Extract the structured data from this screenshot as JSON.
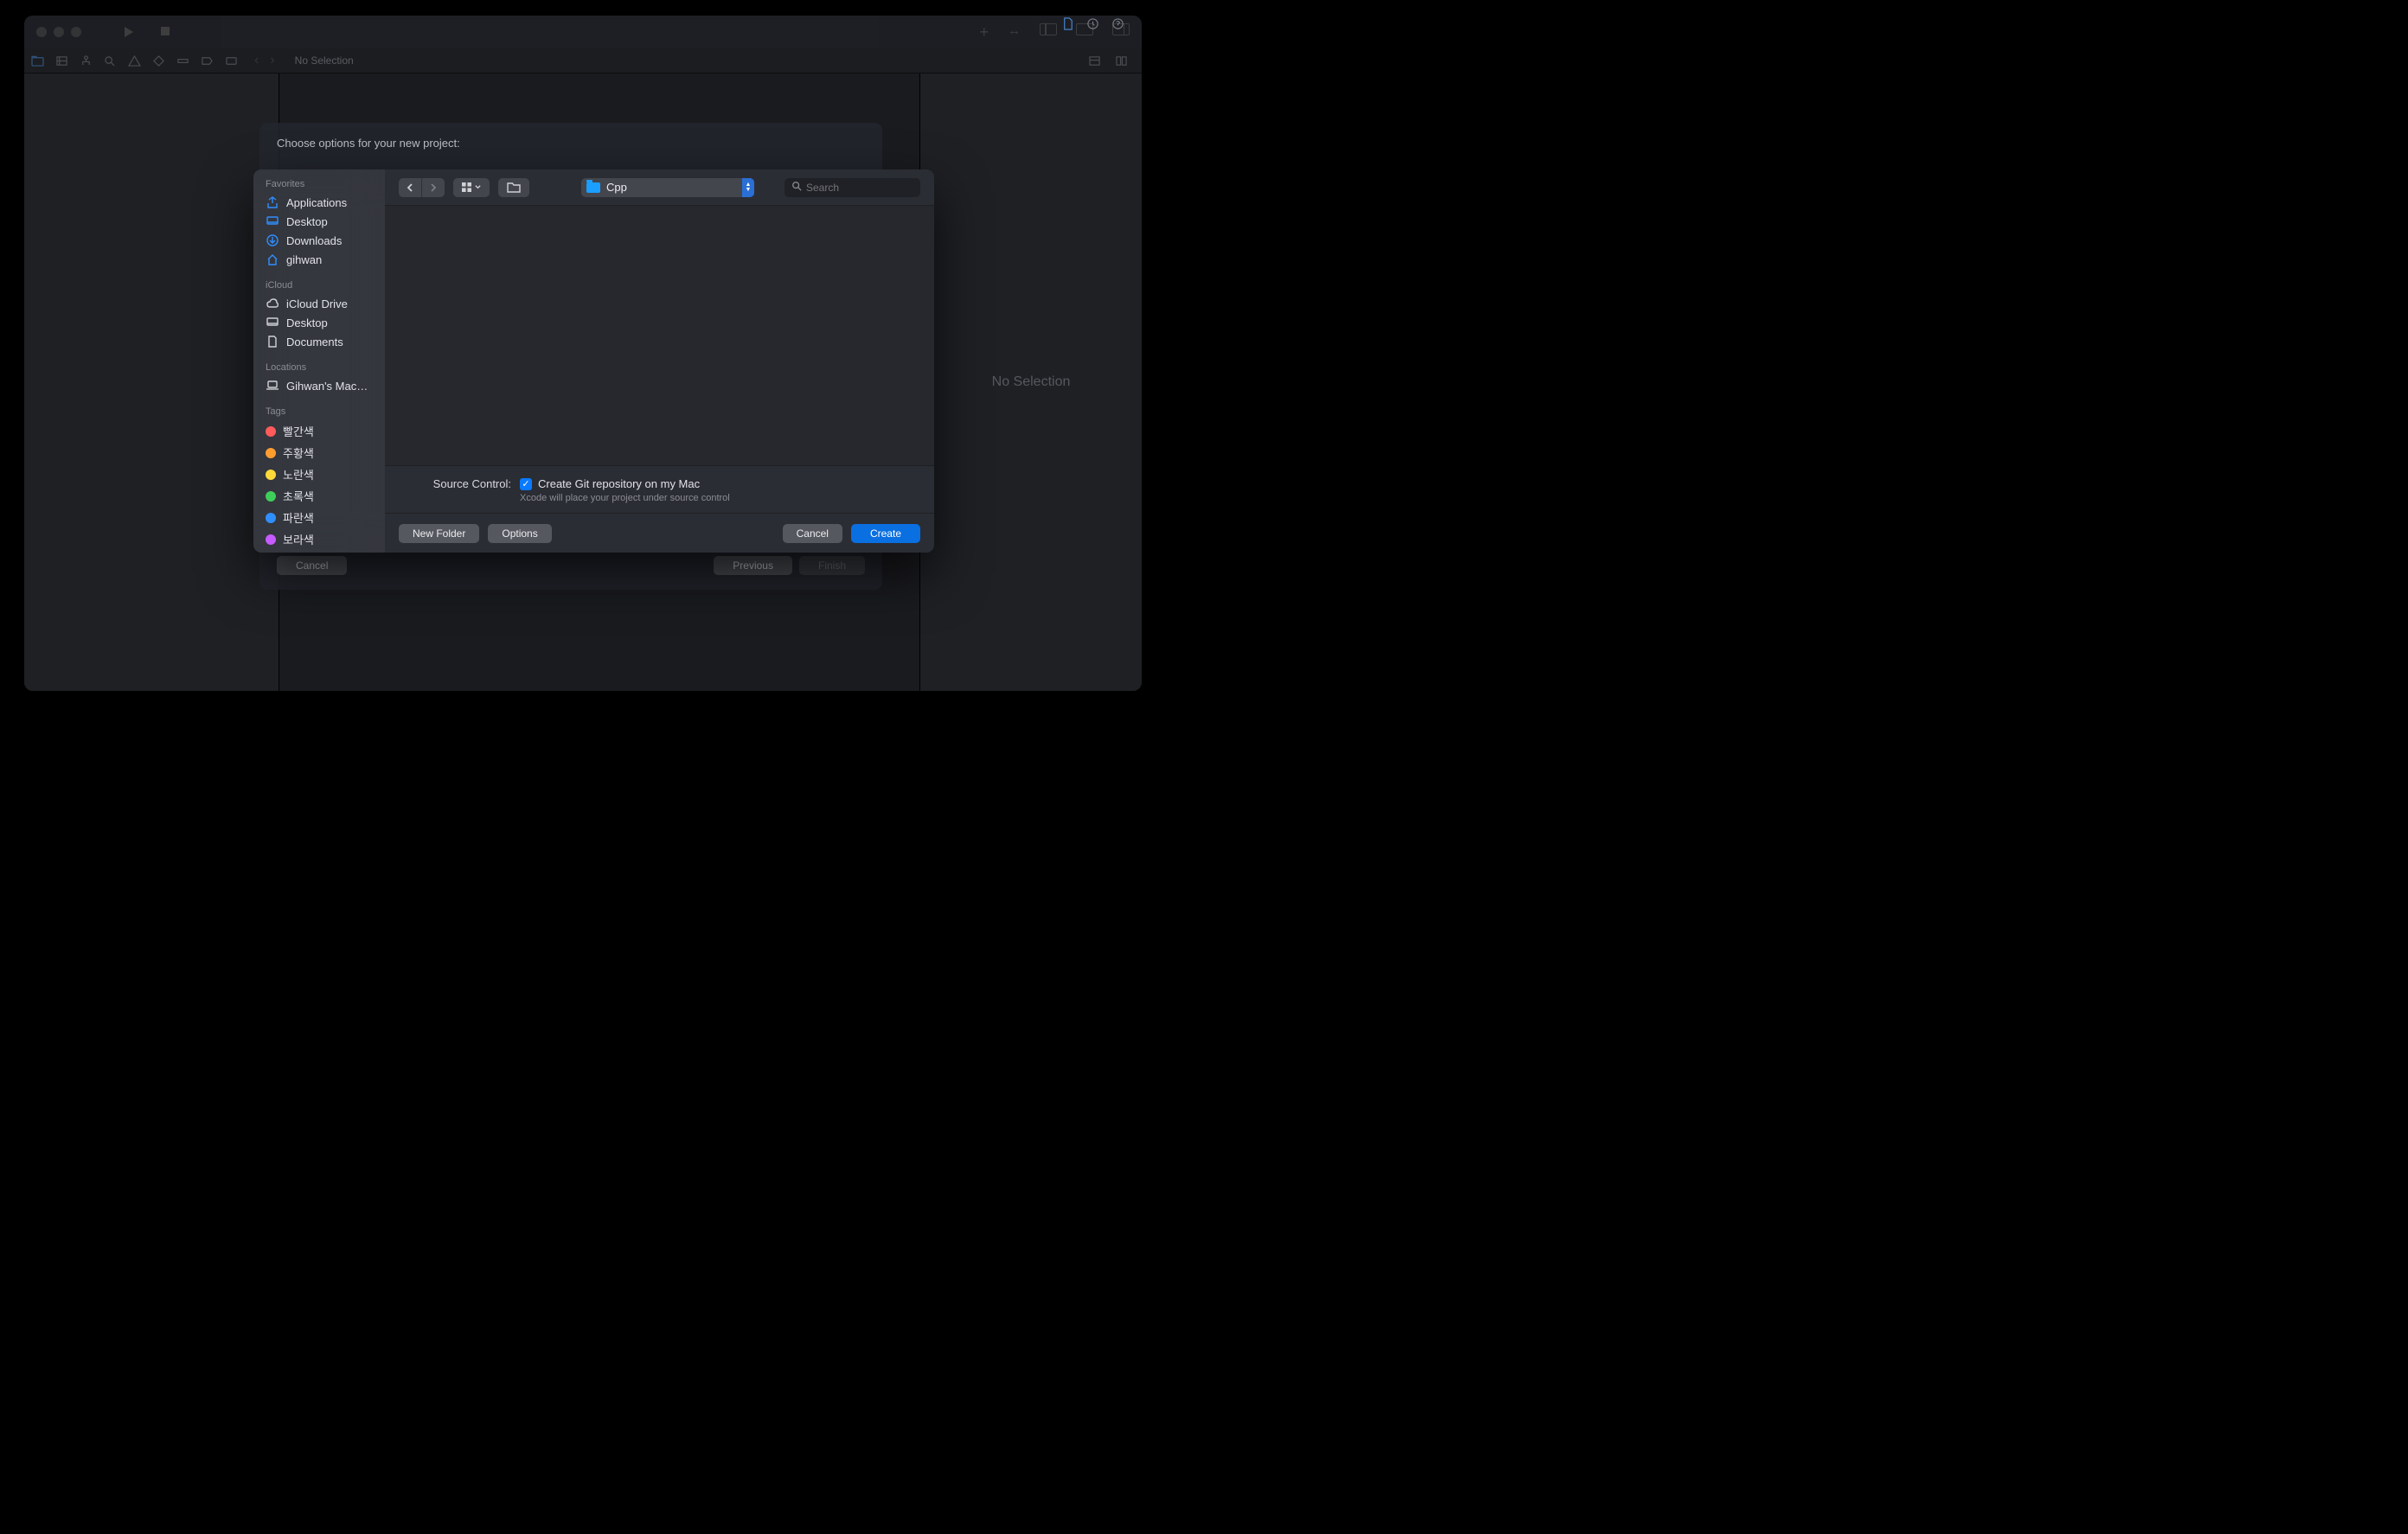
{
  "xcode": {
    "no_selection_tab": "No Selection",
    "no_selection_right": "No Selection"
  },
  "wizard": {
    "title": "Choose options for your new project:",
    "cancel": "Cancel",
    "previous": "Previous",
    "finish": "Finish"
  },
  "save_panel": {
    "sidebar": {
      "favorites_header": "Favorites",
      "favorites": [
        {
          "label": "Applications",
          "icon": "apps"
        },
        {
          "label": "Desktop",
          "icon": "desktop"
        },
        {
          "label": "Downloads",
          "icon": "downloads"
        },
        {
          "label": "gihwan",
          "icon": "home"
        }
      ],
      "icloud_header": "iCloud",
      "icloud": [
        {
          "label": "iCloud Drive",
          "icon": "cloud"
        },
        {
          "label": "Desktop",
          "icon": "desktop"
        },
        {
          "label": "Documents",
          "icon": "doc"
        }
      ],
      "locations_header": "Locations",
      "locations": [
        {
          "label": "Gihwan's Mac…",
          "icon": "laptop"
        }
      ],
      "tags_header": "Tags",
      "tags": [
        {
          "label": "빨간색",
          "color": "#ff5b5b"
        },
        {
          "label": "주황색",
          "color": "#ff9d2f"
        },
        {
          "label": "노란색",
          "color": "#ffd93a"
        },
        {
          "label": "초록색",
          "color": "#3ecf5a"
        },
        {
          "label": "파란색",
          "color": "#2f8fff"
        },
        {
          "label": "보라색",
          "color": "#c65bff"
        }
      ]
    },
    "current_folder": "Cpp",
    "search_placeholder": "Search",
    "source_control": {
      "label": "Source Control:",
      "checkbox_label": "Create Git repository on my Mac",
      "checked": true,
      "hint": "Xcode will place your project under source control"
    },
    "buttons": {
      "new_folder": "New Folder",
      "options": "Options",
      "cancel": "Cancel",
      "create": "Create"
    }
  }
}
